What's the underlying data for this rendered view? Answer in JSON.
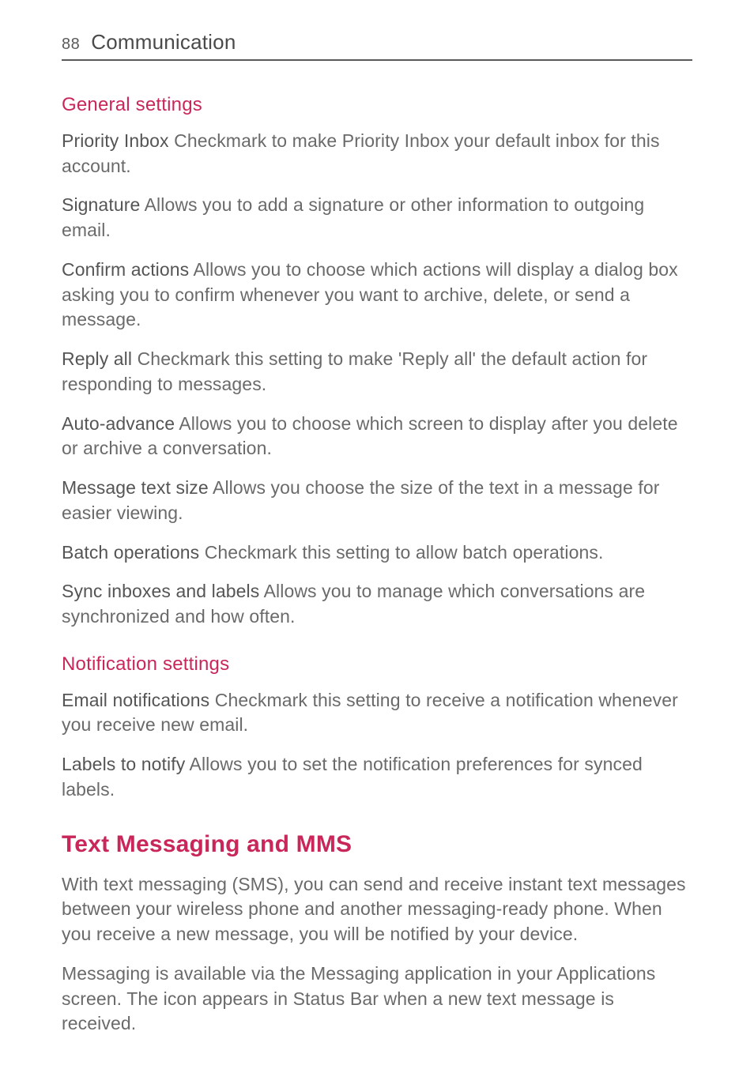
{
  "header": {
    "page_number": "88",
    "chapter": "Communication"
  },
  "sections": [
    {
      "heading": "General settings",
      "items": [
        {
          "term": "Priority Inbox",
          "desc": " Checkmark to make Priority Inbox your default inbox for this account."
        },
        {
          "term": "Signature",
          "desc": "  Allows you to add a signature or other information to outgoing email."
        },
        {
          "term": "Confirm actions",
          "desc": "  Allows you to choose which actions will display a dialog box asking you to confirm whenever you want to archive, delete, or send a message."
        },
        {
          "term": "Reply all",
          "desc": " Checkmark this setting to make 'Reply all' the default action for responding to messages."
        },
        {
          "term": "Auto-advance",
          "desc": " Allows you to choose which screen to display after you delete or archive a conversation."
        },
        {
          "term": "Message text size",
          "desc": " Allows you choose the size of the text in a message for easier viewing."
        },
        {
          "term": "Batch operations",
          "desc": " Checkmark this setting to allow batch operations."
        },
        {
          "term": "Sync inboxes and labels",
          "desc": " Allows you to manage which conversations are synchronized and how often."
        }
      ]
    },
    {
      "heading": "Notification settings",
      "items": [
        {
          "term": "Email notifications",
          "desc": "  Checkmark this setting to receive a notification whenever you receive new email."
        },
        {
          "term": "Labels to notify",
          "desc": " Allows you to set the notification preferences for synced labels."
        }
      ]
    }
  ],
  "major_section": {
    "title": "Text Messaging and MMS",
    "paragraphs": [
      "With text messaging (SMS), you can send and receive instant text messages between your wireless phone and another messaging-ready phone. When you receive a new message, you will be notified by your device.",
      "Messaging is available via the Messaging application in your Applications screen. The icon appears in Status Bar when a new text message is received."
    ]
  }
}
